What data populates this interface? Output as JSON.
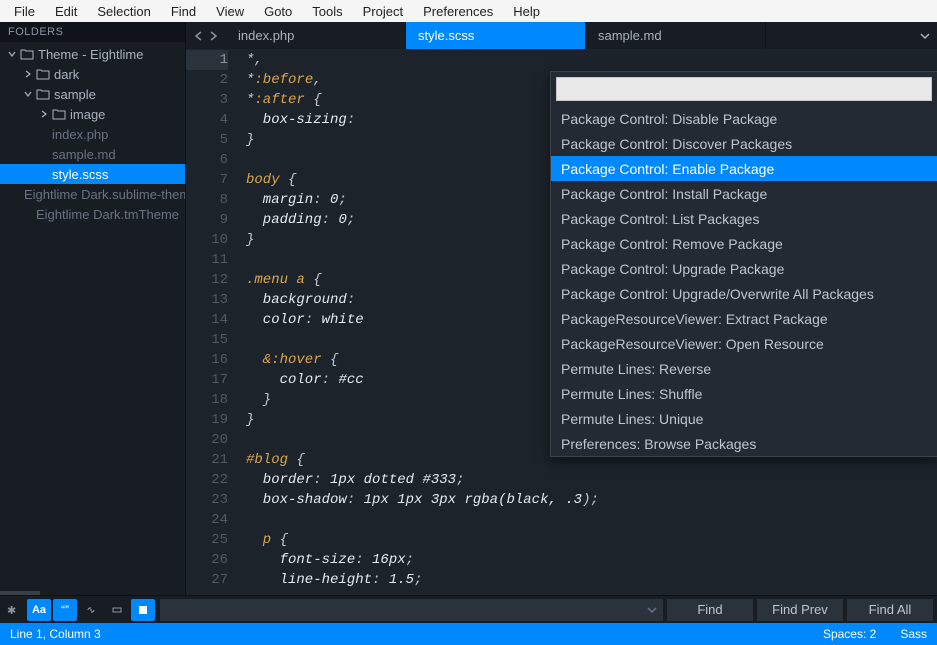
{
  "menubar": [
    "File",
    "Edit",
    "Selection",
    "Find",
    "View",
    "Goto",
    "Tools",
    "Project",
    "Preferences",
    "Help"
  ],
  "sidebar": {
    "header": "FOLDERS",
    "tree": [
      {
        "depth": 0,
        "type": "folder",
        "open": true,
        "label": "Theme - Eightlime"
      },
      {
        "depth": 1,
        "type": "folder",
        "open": false,
        "label": "dark"
      },
      {
        "depth": 1,
        "type": "folder",
        "open": true,
        "label": "sample"
      },
      {
        "depth": 2,
        "type": "folder",
        "open": false,
        "label": "image"
      },
      {
        "depth": 2,
        "type": "file",
        "dim": true,
        "label": "index.php"
      },
      {
        "depth": 2,
        "type": "file",
        "dim": true,
        "label": "sample.md"
      },
      {
        "depth": 2,
        "type": "file",
        "selected": true,
        "label": "style.scss"
      },
      {
        "depth": 1,
        "type": "file",
        "dim": true,
        "label": "Eightlime Dark.sublime-theme"
      },
      {
        "depth": 1,
        "type": "file",
        "dim": true,
        "label": "Eightlime Dark.tmTheme"
      }
    ]
  },
  "tabs": {
    "items": [
      {
        "label": "index.php",
        "active": false
      },
      {
        "label": "style.scss",
        "active": true
      },
      {
        "label": "sample.md",
        "active": false
      }
    ]
  },
  "code": {
    "lines": [
      [
        {
          "c": "punct",
          "t": "*,"
        }
      ],
      [
        {
          "c": "punct",
          "t": "*"
        },
        {
          "c": "sel",
          "t": ":before"
        },
        {
          "c": "punct",
          "t": ","
        }
      ],
      [
        {
          "c": "punct",
          "t": "*"
        },
        {
          "c": "sel",
          "t": ":after"
        },
        {
          "c": "punct",
          "t": " {"
        }
      ],
      [
        {
          "c": "prop",
          "t": "  box-sizing"
        },
        {
          "c": "punct",
          "t": ":"
        }
      ],
      [
        {
          "c": "punct",
          "t": "}"
        }
      ],
      [],
      [
        {
          "c": "sel",
          "t": "body"
        },
        {
          "c": "punct",
          "t": " {"
        }
      ],
      [
        {
          "c": "prop",
          "t": "  margin"
        },
        {
          "c": "punct",
          "t": ": "
        },
        {
          "c": "num",
          "t": "0"
        },
        {
          "c": "punct",
          "t": ";"
        }
      ],
      [
        {
          "c": "prop",
          "t": "  padding"
        },
        {
          "c": "punct",
          "t": ": "
        },
        {
          "c": "num",
          "t": "0"
        },
        {
          "c": "punct",
          "t": ";"
        }
      ],
      [
        {
          "c": "punct",
          "t": "}"
        }
      ],
      [],
      [
        {
          "c": "sel",
          "t": ".menu a"
        },
        {
          "c": "punct",
          "t": " {"
        }
      ],
      [
        {
          "c": "prop",
          "t": "  background"
        },
        {
          "c": "punct",
          "t": ":"
        }
      ],
      [
        {
          "c": "prop",
          "t": "  color"
        },
        {
          "c": "punct",
          "t": ": "
        },
        {
          "c": "val",
          "t": "white"
        }
      ],
      [],
      [
        {
          "c": "sel",
          "t": "  &:hover"
        },
        {
          "c": "punct",
          "t": " {"
        }
      ],
      [
        {
          "c": "prop",
          "t": "    color"
        },
        {
          "c": "punct",
          "t": ": "
        },
        {
          "c": "val",
          "t": "#cc"
        }
      ],
      [
        {
          "c": "punct",
          "t": "  }"
        }
      ],
      [
        {
          "c": "punct",
          "t": "}"
        }
      ],
      [],
      [
        {
          "c": "sel",
          "t": "#blog"
        },
        {
          "c": "punct",
          "t": " {"
        }
      ],
      [
        {
          "c": "prop",
          "t": "  border"
        },
        {
          "c": "punct",
          "t": ": "
        },
        {
          "c": "num",
          "t": "1px"
        },
        {
          "c": "val",
          "t": " dotted "
        },
        {
          "c": "num",
          "t": "#333"
        },
        {
          "c": "punct",
          "t": ";"
        }
      ],
      [
        {
          "c": "prop",
          "t": "  box-shadow"
        },
        {
          "c": "punct",
          "t": ": "
        },
        {
          "c": "num",
          "t": "1px 1px 3px"
        },
        {
          "c": "val",
          "t": " rgba(black, "
        },
        {
          "c": "num",
          "t": ".3"
        },
        {
          "c": "punct",
          "t": ");"
        }
      ],
      [],
      [
        {
          "c": "sel",
          "t": "  p"
        },
        {
          "c": "punct",
          "t": " {"
        }
      ],
      [
        {
          "c": "prop",
          "t": "    font-size"
        },
        {
          "c": "punct",
          "t": ": "
        },
        {
          "c": "num",
          "t": "16px"
        },
        {
          "c": "punct",
          "t": ";"
        }
      ],
      [
        {
          "c": "prop",
          "t": "    line-height"
        },
        {
          "c": "punct",
          "t": ": "
        },
        {
          "c": "num",
          "t": "1.5"
        },
        {
          "c": "punct",
          "t": ";"
        }
      ]
    ],
    "active_line": 1
  },
  "command_palette": {
    "items": [
      "Package Control: Disable Package",
      "Package Control: Discover Packages",
      "Package Control: Enable Package",
      "Package Control: Install Package",
      "Package Control: List Packages",
      "Package Control: Remove Package",
      "Package Control: Upgrade Package",
      "Package Control: Upgrade/Overwrite All Packages",
      "PackageResourceViewer: Extract Package",
      "PackageResourceViewer: Open Resource",
      "Permute Lines: Reverse",
      "Permute Lines: Shuffle",
      "Permute Lines: Unique",
      "Preferences: Browse Packages"
    ],
    "selected_index": 2
  },
  "findbar": {
    "buttons": {
      "find": "Find",
      "find_prev": "Find Prev",
      "find_all": "Find All"
    }
  },
  "statusbar": {
    "position": "Line 1, Column 3",
    "spaces": "Spaces: 2",
    "syntax": "Sass"
  }
}
